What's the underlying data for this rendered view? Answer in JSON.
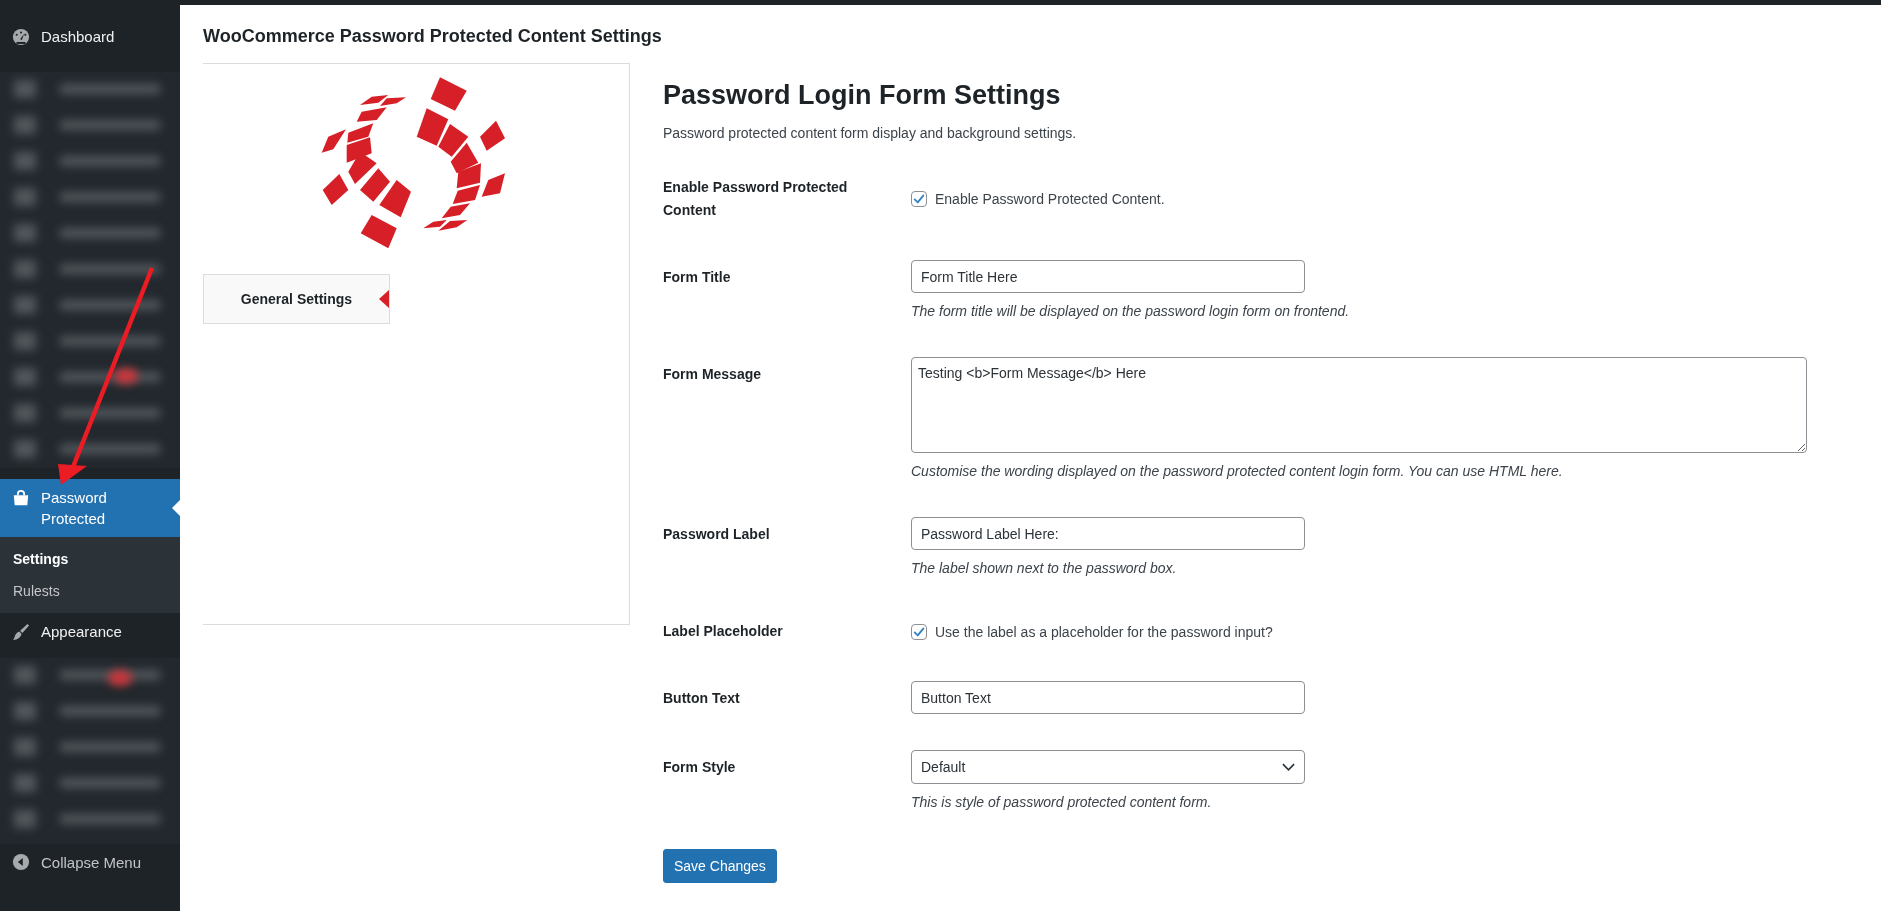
{
  "sidebar": {
    "items": [
      {
        "kind": "item",
        "label": "Dashboard",
        "selected": false
      },
      {
        "kind": "blurred"
      },
      {
        "kind": "item",
        "label": "Password Protected",
        "selected": true,
        "children": [
          {
            "label": "Settings",
            "selected": true
          },
          {
            "label": "Rulests",
            "selected": false
          }
        ]
      },
      {
        "kind": "item",
        "label": "Appearance",
        "selected": false
      },
      {
        "kind": "blurred"
      }
    ],
    "collapse_label": "Collapse Menu"
  },
  "page_title": "WooCommerce Password Protected Content Settings",
  "plugin_panel": {
    "tabs": [
      {
        "label": "General Settings",
        "selected": true
      }
    ]
  },
  "settings": {
    "title": "Password Login Form Settings",
    "subtitle": "Password protected content form display and background settings.",
    "rows": [
      {
        "kind": "checkbox",
        "label": "Enable Password Protected Content",
        "checked": true,
        "option_label": "Enable Password Protected Content."
      },
      {
        "kind": "text",
        "label": "Form Title",
        "value": "Form Title Here",
        "description": "The form title will be displayed on the password login form on frontend."
      },
      {
        "kind": "textarea",
        "label": "Form Message",
        "value": "Testing <b>Form Message</b> Here",
        "description": "Customise the wording displayed on the password protected content login form. You can use HTML here."
      },
      {
        "kind": "text",
        "label": "Password Label",
        "value": "Password Label Here:",
        "description": "The label shown next to the password box."
      },
      {
        "kind": "checkbox",
        "label": "Label Placeholder",
        "checked": true,
        "option_label": "Use the label as a placeholder for the password input?"
      },
      {
        "kind": "text",
        "label": "Button Text",
        "value": "Button Text"
      },
      {
        "kind": "select",
        "label": "Form Style",
        "value": "Default",
        "description": "This is style of password protected content form."
      }
    ],
    "save_button": "Save Changes"
  }
}
